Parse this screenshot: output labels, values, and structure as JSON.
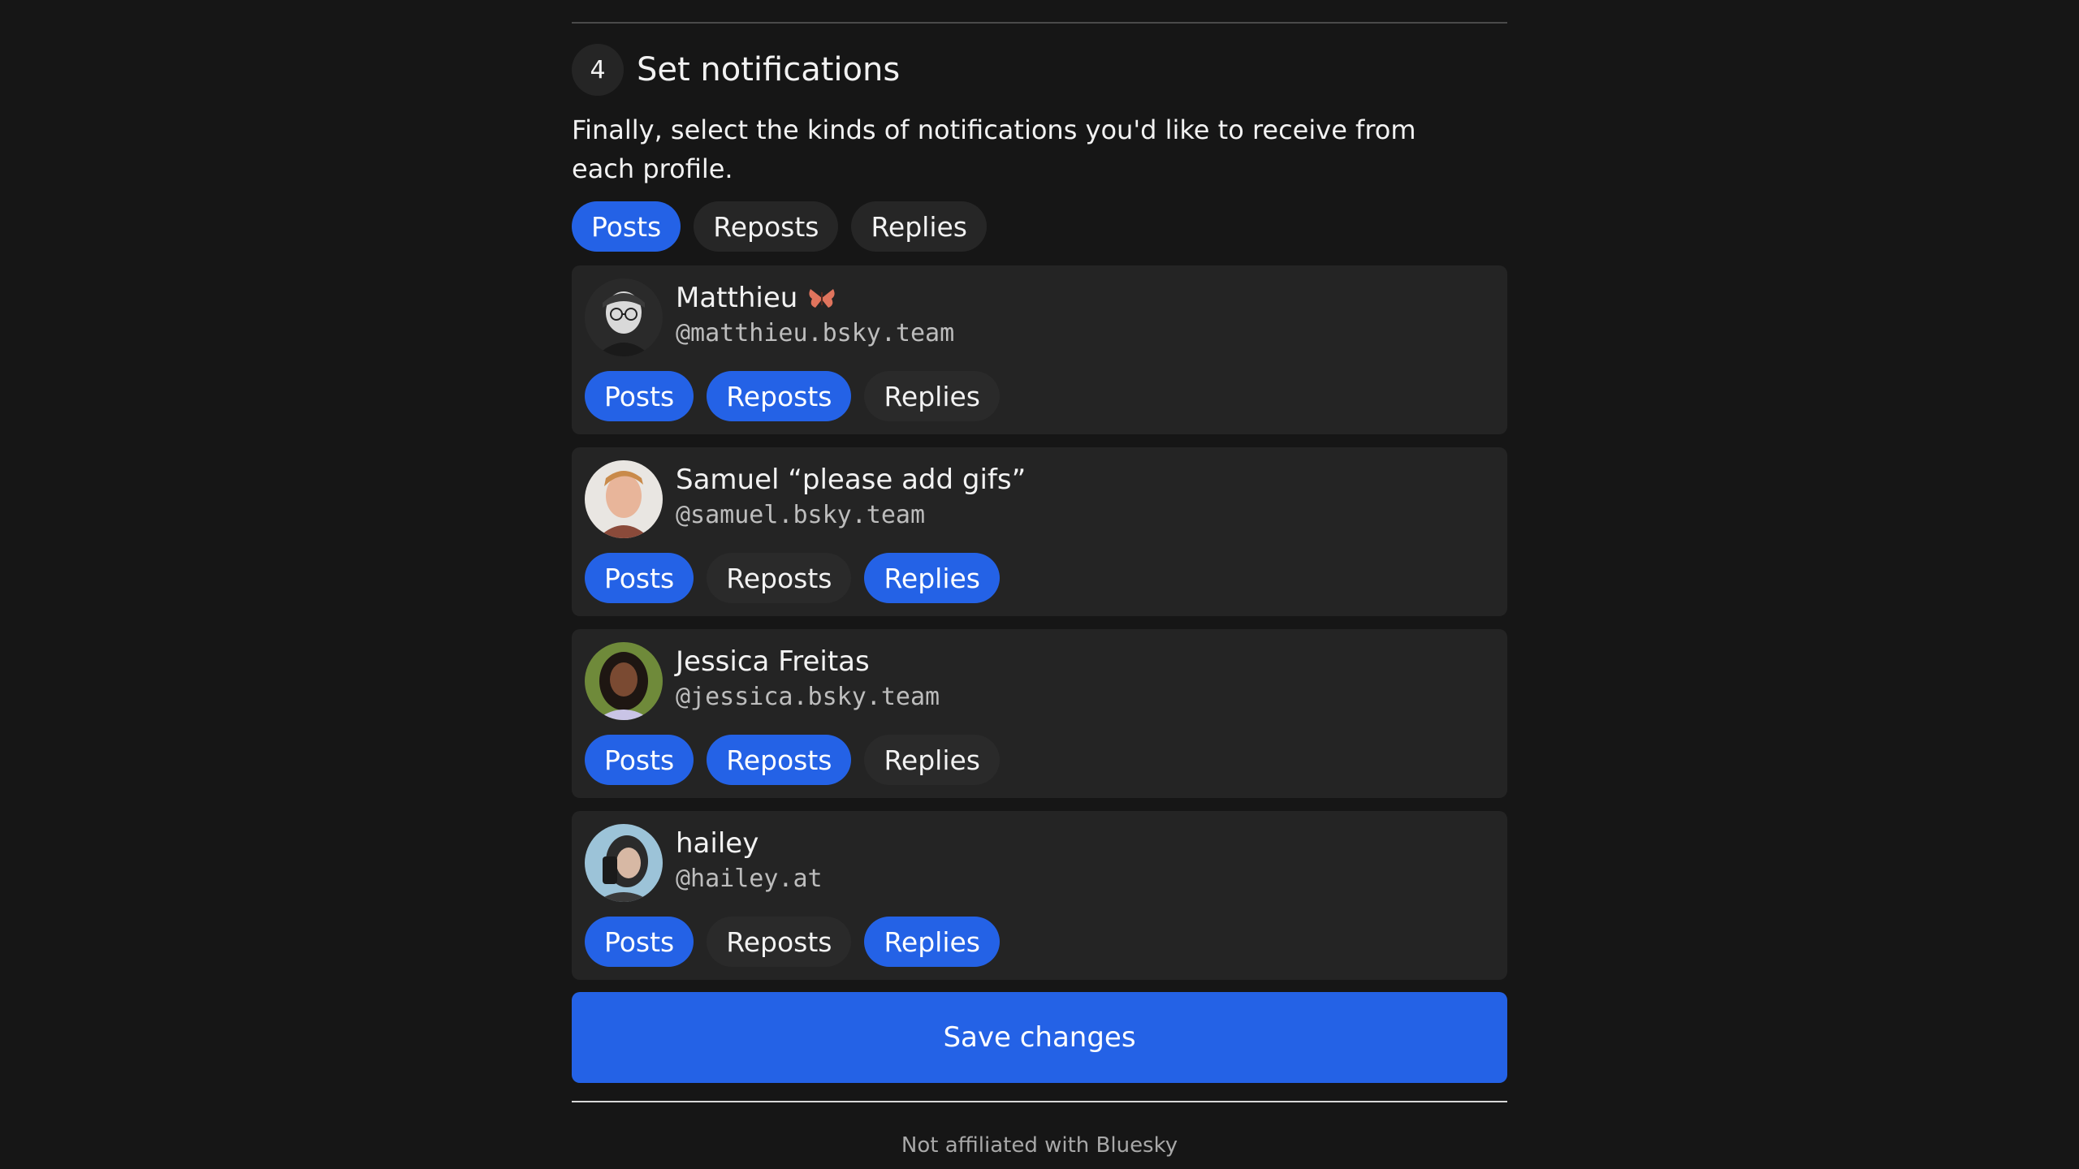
{
  "step": {
    "number": "4",
    "title": "Set notifications",
    "intro": "Finally, select the kinds of notifications you'd like to receive from each profile."
  },
  "global_filters": [
    {
      "label": "Posts",
      "selected": true
    },
    {
      "label": "Reposts",
      "selected": false
    },
    {
      "label": "Replies",
      "selected": false
    }
  ],
  "profiles": [
    {
      "name": "Matthieu",
      "emoji": "butterfly-icon",
      "handle": "@matthieu.bsky.team",
      "chips": [
        {
          "label": "Posts",
          "selected": true
        },
        {
          "label": "Reposts",
          "selected": true
        },
        {
          "label": "Replies",
          "selected": false
        }
      ]
    },
    {
      "name": "Samuel “please add gifs”",
      "handle": "@samuel.bsky.team",
      "chips": [
        {
          "label": "Posts",
          "selected": true
        },
        {
          "label": "Reposts",
          "selected": false
        },
        {
          "label": "Replies",
          "selected": true
        }
      ]
    },
    {
      "name": "Jessica Freitas",
      "handle": "@jessica.bsky.team",
      "chips": [
        {
          "label": "Posts",
          "selected": true
        },
        {
          "label": "Reposts",
          "selected": true
        },
        {
          "label": "Replies",
          "selected": false
        }
      ]
    },
    {
      "name": "hailey",
      "handle": "@hailey.at",
      "chips": [
        {
          "label": "Posts",
          "selected": true
        },
        {
          "label": "Reposts",
          "selected": false
        },
        {
          "label": "Replies",
          "selected": true
        }
      ]
    }
  ],
  "save_label": "Save changes",
  "footer": "Not affiliated with Bluesky",
  "colors": {
    "background": "#161616",
    "card": "#242424",
    "accent": "#2462e6",
    "chip_off": "#2a2a2a"
  }
}
